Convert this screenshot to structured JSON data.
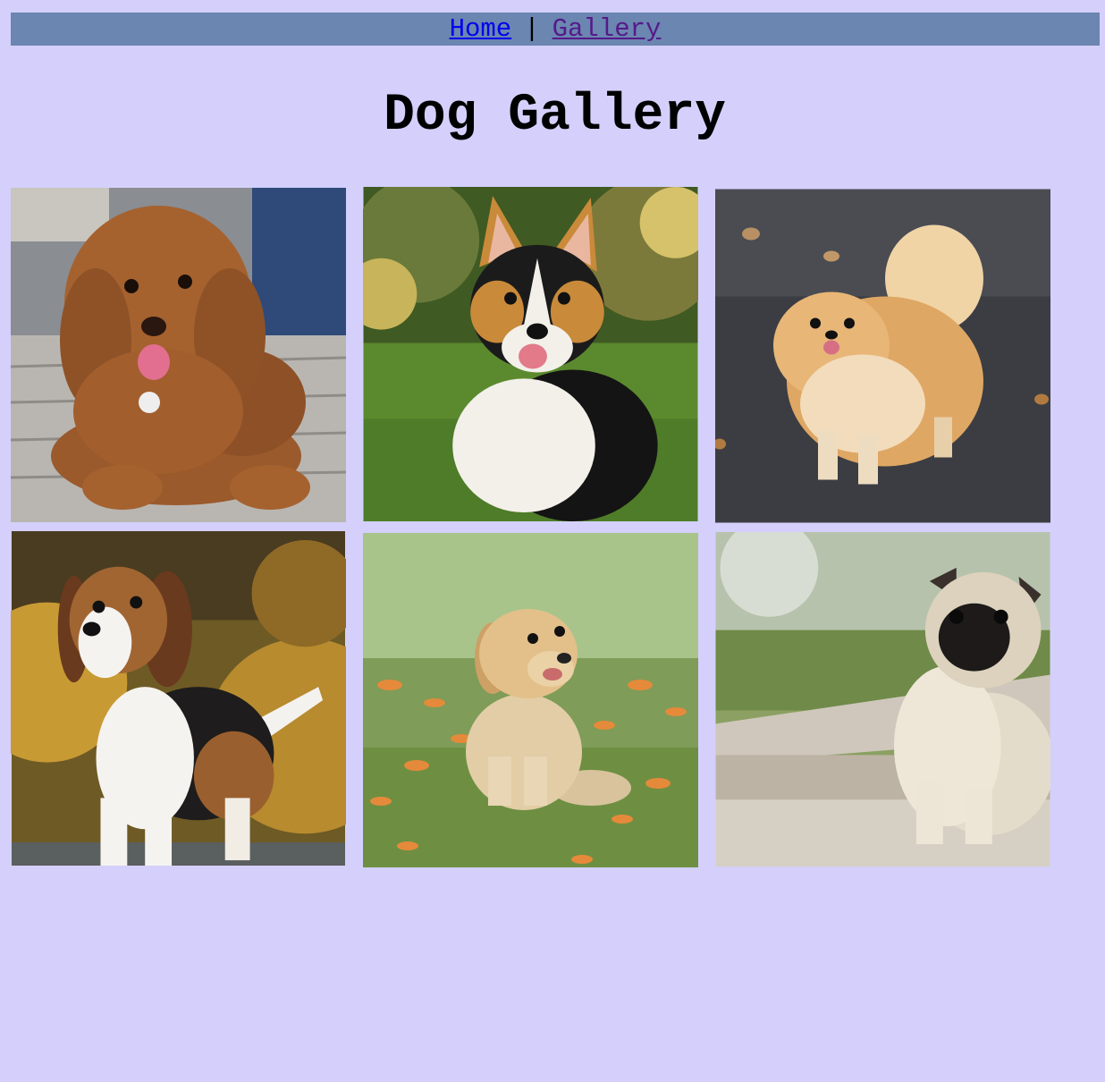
{
  "nav": {
    "home_label": "Home",
    "separator": "|",
    "gallery_label": "Gallery"
  },
  "page_title": "Dog Gallery",
  "gallery": [
    {
      "subject": "red toy poodle puppy lying on wooden bench",
      "icon": "poodle-photo"
    },
    {
      "subject": "tricolor corgi sitting on grass",
      "icon": "corgi-photo"
    },
    {
      "subject": "pomeranian standing on asphalt",
      "icon": "pomeranian-photo"
    },
    {
      "subject": "beagle puppy standing with autumn background",
      "icon": "beagle-photo"
    },
    {
      "subject": "golden retriever puppy sitting in field with orange petals",
      "icon": "golden-retriever-photo"
    },
    {
      "subject": "pug sitting on gravel path",
      "icon": "pug-photo"
    }
  ],
  "colors": {
    "page_background": "#d4d0fb",
    "navbar_background": "#6b86b0",
    "link": "#0000ee",
    "visited_link": "#551a8b"
  }
}
